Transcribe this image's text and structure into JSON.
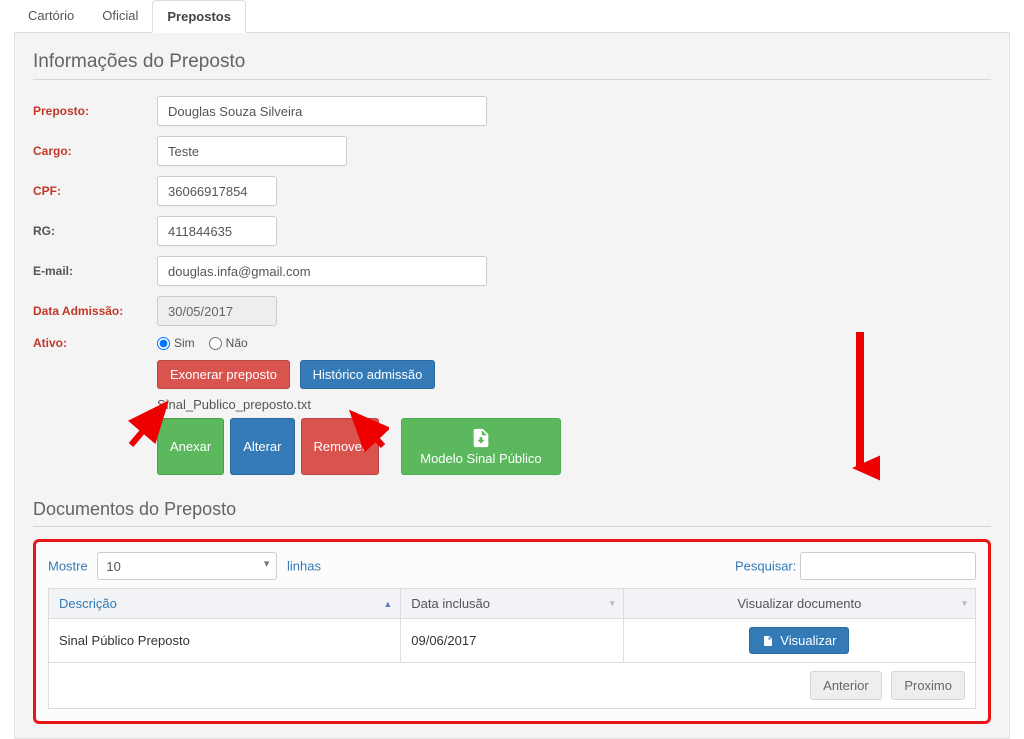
{
  "tabs": {
    "cartorio": "Cartório",
    "oficial": "Oficial",
    "prepostos": "Prepostos"
  },
  "section1_title": "Informações do Preposto",
  "labels": {
    "preposto": "Preposto:",
    "cargo": "Cargo:",
    "cpf": "CPF:",
    "rg": "RG:",
    "email": "E-mail:",
    "admissao": "Data Admissão:",
    "ativo": "Ativo:"
  },
  "values": {
    "preposto": "Douglas Souza Silveira",
    "cargo": "Teste",
    "cpf": "36066917854",
    "rg": "411844635",
    "email": "douglas.infa@gmail.com",
    "admissao": "30/05/2017"
  },
  "ativo": {
    "sim": "Sim",
    "nao": "Não",
    "selected": "sim"
  },
  "buttons": {
    "exonerar": "Exonerar preposto",
    "historico": "Histórico admissão",
    "anexar": "Anexar",
    "alterar": "Alterar",
    "remover": "Remover",
    "modelo": "Modelo Sinal Público",
    "visualizar": "Visualizar",
    "anterior": "Anterior",
    "proximo": "Proximo"
  },
  "file_name": "Sinal_Publico_preposto.txt",
  "section2_title": "Documentos do Preposto",
  "table": {
    "mostre": "Mostre",
    "linhas": "linhas",
    "pesquisar": "Pesquisar:",
    "page_size": "10",
    "headers": {
      "descricao": "Descrição",
      "data": "Data inclusão",
      "visualizar": "Visualizar documento"
    },
    "rows": [
      {
        "descricao": "Sinal Público Preposto",
        "data": "09/06/2017"
      }
    ]
  }
}
